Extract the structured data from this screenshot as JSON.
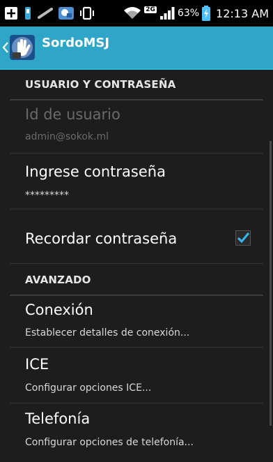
{
  "status_bar": {
    "battery": "63%",
    "time": "12:13 AM",
    "network_badge": "2G",
    "icons": [
      "add-icon",
      "usb-debug-icon",
      "notification-icon",
      "app-notification-icon",
      "vibrate-icon",
      "wifi-icon",
      "signal-icon",
      "battery-charging-icon"
    ]
  },
  "app_bar": {
    "title": "SordoMSJ",
    "icon": "sign-language-hand-icon",
    "back_icon": "chevron-left-icon",
    "accent": "#2fa6c8"
  },
  "sections": {
    "user": {
      "header": "USUARIO Y CONTRASEÑA"
    },
    "advanced": {
      "header": "AVANZADO"
    }
  },
  "prefs": {
    "user_id": {
      "title": "Id de usuario",
      "summary": "admin@sokok.ml",
      "enabled": false
    },
    "password": {
      "title": "Ingrese contraseña",
      "summary": "*********"
    },
    "remember": {
      "title": "Recordar contraseña",
      "checked": true,
      "check_color": "#33b5e5"
    },
    "connection": {
      "title": "Conexión",
      "summary": "Establecer detalles de conexión..."
    },
    "ice": {
      "title": "ICE",
      "summary": "Configurar opciones ICE..."
    },
    "telephony": {
      "title": "Telefonía",
      "summary": "Configurar opciones de telefonía..."
    }
  }
}
